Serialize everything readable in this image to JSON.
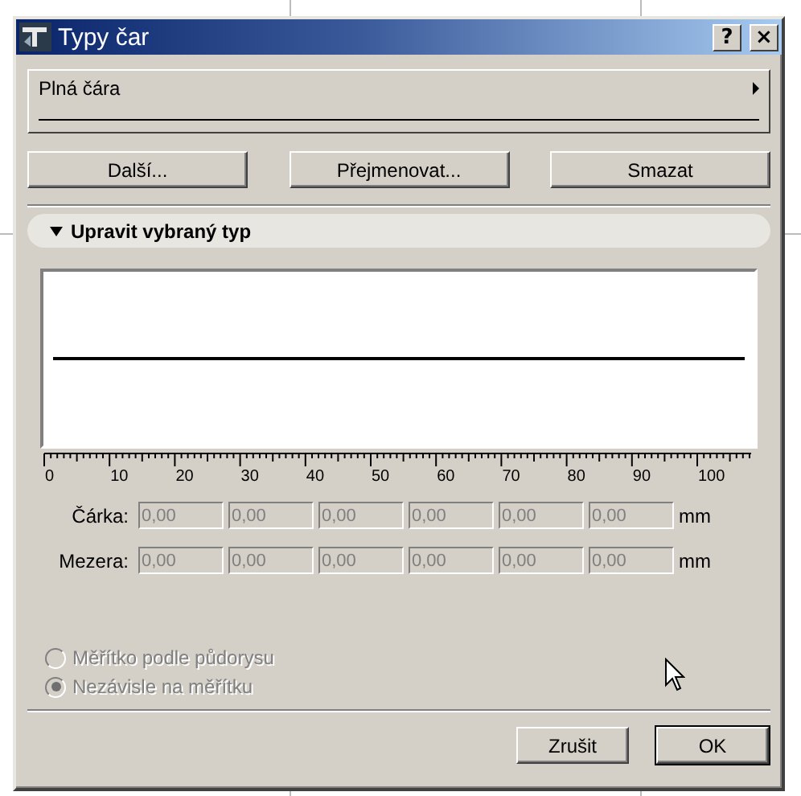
{
  "window": {
    "title": "Typy čar",
    "help": "?",
    "close": "×"
  },
  "line_type": {
    "name": "Plná čára"
  },
  "actions": [
    {
      "label": "Další..."
    },
    {
      "label": "Přejmenovat..."
    },
    {
      "label": "Smazat"
    }
  ],
  "section": {
    "title": "Upravit vybraný typ",
    "expanded": true
  },
  "ruler": [
    "0",
    "10",
    "20",
    "30",
    "40",
    "50",
    "60",
    "70",
    "80",
    "90",
    "100"
  ],
  "rows": [
    {
      "label": "Čárka:",
      "values": [
        "0,00",
        "0,00",
        "0,00",
        "0,00",
        "0,00",
        "0,00"
      ],
      "unit": "mm",
      "disabled": true
    },
    {
      "label": "Mezera:",
      "values": [
        "0,00",
        "0,00",
        "0,00",
        "0,00",
        "0,00",
        "0,00"
      ],
      "unit": "mm",
      "disabled": true
    }
  ],
  "scale_options": [
    {
      "label": "Měřítko podle půdorysu",
      "selected": false,
      "disabled": true
    },
    {
      "label": "Nezávisle na měřítku",
      "selected": true,
      "disabled": true
    }
  ],
  "buttons": [
    {
      "label": "Zrušit",
      "default": false
    },
    {
      "label": "OK",
      "default": true
    }
  ]
}
